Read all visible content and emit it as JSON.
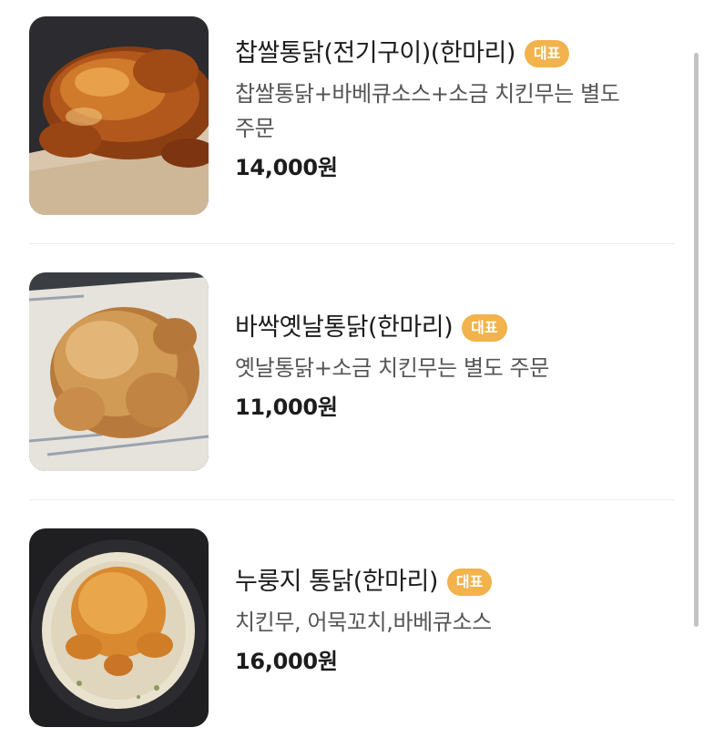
{
  "menu": {
    "items": [
      {
        "name": "찹쌀통닭(전기구이)(한마리)",
        "badge": "대표",
        "description": "찹쌀통닭+바베큐소스+소금 치킨무는 별도 주문",
        "description_line1": "찹쌀통닭+바베큐소스+소금 치킨무는 별도",
        "description_line2": "주문",
        "price": "14,000원",
        "image_icon": "roast-chicken-photo"
      },
      {
        "name": "바싹옛날통닭(한마리)",
        "badge": "대표",
        "description": "옛날통닭+소금 치킨무는 별도 주문",
        "price": "11,000원",
        "image_icon": "fried-chicken-photo"
      },
      {
        "name": "누룽지 통닭(한마리)",
        "badge": "대표",
        "description": "치킨무, 어묵꼬치,바베큐소스",
        "price": "16,000원",
        "image_icon": "nurungji-chicken-photo"
      }
    ]
  },
  "colors": {
    "badge_background": "#f2b24c",
    "badge_text": "#ffffff",
    "title_text": "#1c1c1c",
    "description_text": "#555555",
    "divider": "#ececec",
    "scrollbar": "#c4c4c4"
  }
}
